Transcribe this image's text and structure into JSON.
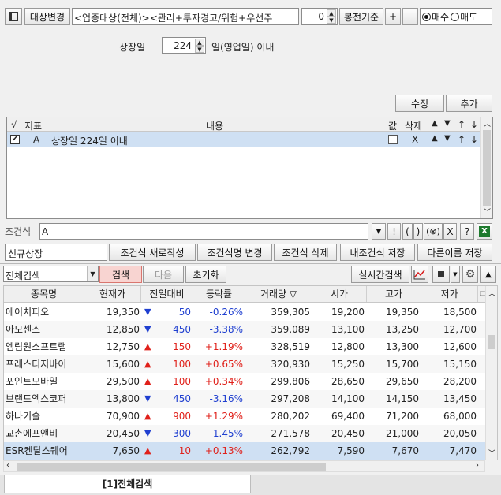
{
  "toolbar": {
    "target_change": "대상변경",
    "condition_text": "<업종대상(전체)><관리+투자경고/위험+우선주",
    "count_value": "0",
    "basis": "봉전기준",
    "plus": "+",
    "minus": "-",
    "radio_buy": "매수",
    "radio_sell": "매도"
  },
  "listing": {
    "label": "상장일",
    "value": "224",
    "suffix": "일(영업일) 이내"
  },
  "actions": {
    "edit": "수정",
    "add": "추가"
  },
  "cond_table": {
    "headers": {
      "check": "√",
      "indicator": "지표",
      "content": "내용",
      "value": "값",
      "delete": "삭제",
      "up": "▲",
      "down": "▼",
      "top": "↑",
      "bottom": "↓"
    },
    "row": {
      "indicator": "A",
      "content": "상장일 224일 이내",
      "delete": "X",
      "up": "▲",
      "down": "▼",
      "top": "↑",
      "bottom": "↓"
    }
  },
  "formula": {
    "label": "조건식",
    "value": "A",
    "ops": [
      "!",
      "(",
      ")",
      "(⊗)",
      "X",
      "?"
    ]
  },
  "formula_buttons": {
    "name_field": "신규상장",
    "new": "조건식 새로작성",
    "rename": "조건식명 변경",
    "delete": "조건식 삭제",
    "save": "내조건식 저장",
    "save_as": "다른이름 저장"
  },
  "search_bar": {
    "scope": "전체검색",
    "search": "검색",
    "next": "다음",
    "reset": "초기화",
    "realtime": "실시간검색"
  },
  "results": {
    "columns": [
      "종목명",
      "현재가",
      "전일대비",
      "등락률",
      "거래량 ▽",
      "시가",
      "고가",
      "저가",
      "ㄷ"
    ],
    "rows": [
      {
        "name": "에이치피오",
        "price": "19,350",
        "dir": "down",
        "change": "50",
        "rate": "-0.26%",
        "volume": "359,305",
        "open": "19,200",
        "high": "19,350",
        "low": "18,500"
      },
      {
        "name": "아모센스",
        "price": "12,850",
        "dir": "down",
        "change": "450",
        "rate": "-3.38%",
        "volume": "359,089",
        "open": "13,100",
        "high": "13,250",
        "low": "12,700"
      },
      {
        "name": "엠림원소프트랩",
        "price": "12,750",
        "dir": "up",
        "change": "150",
        "rate": "+1.19%",
        "volume": "328,519",
        "open": "12,800",
        "high": "13,300",
        "low": "12,600"
      },
      {
        "name": "프레스티지바이",
        "price": "15,600",
        "dir": "up",
        "change": "100",
        "rate": "+0.65%",
        "volume": "320,930",
        "open": "15,250",
        "high": "15,700",
        "low": "15,150"
      },
      {
        "name": "포인트모바일",
        "price": "29,500",
        "dir": "up",
        "change": "100",
        "rate": "+0.34%",
        "volume": "299,806",
        "open": "28,650",
        "high": "29,650",
        "low": "28,200"
      },
      {
        "name": "브랜드엑스코퍼",
        "price": "13,800",
        "dir": "down",
        "change": "450",
        "rate": "-3.16%",
        "volume": "297,208",
        "open": "14,100",
        "high": "14,150",
        "low": "13,450"
      },
      {
        "name": "하나기술",
        "price": "70,900",
        "dir": "up",
        "change": "900",
        "rate": "+1.29%",
        "volume": "280,202",
        "open": "69,400",
        "high": "71,200",
        "low": "68,000"
      },
      {
        "name": "교촌에프앤비",
        "price": "20,450",
        "dir": "down",
        "change": "300",
        "rate": "-1.45%",
        "volume": "271,578",
        "open": "20,450",
        "high": "21,000",
        "low": "20,050"
      },
      {
        "name": "ESR켄달스퀘어",
        "price": "7,650",
        "dir": "up",
        "change": "10",
        "rate": "+0.13%",
        "volume": "262,792",
        "open": "7,590",
        "high": "7,670",
        "low": "7,470"
      }
    ]
  },
  "bottom_tab": "[1]전체검색",
  "colors": {
    "up": "#e0201a",
    "down": "#1f3fd0",
    "selected_row": "#cfe0f3",
    "header_bg": "#efefef"
  }
}
